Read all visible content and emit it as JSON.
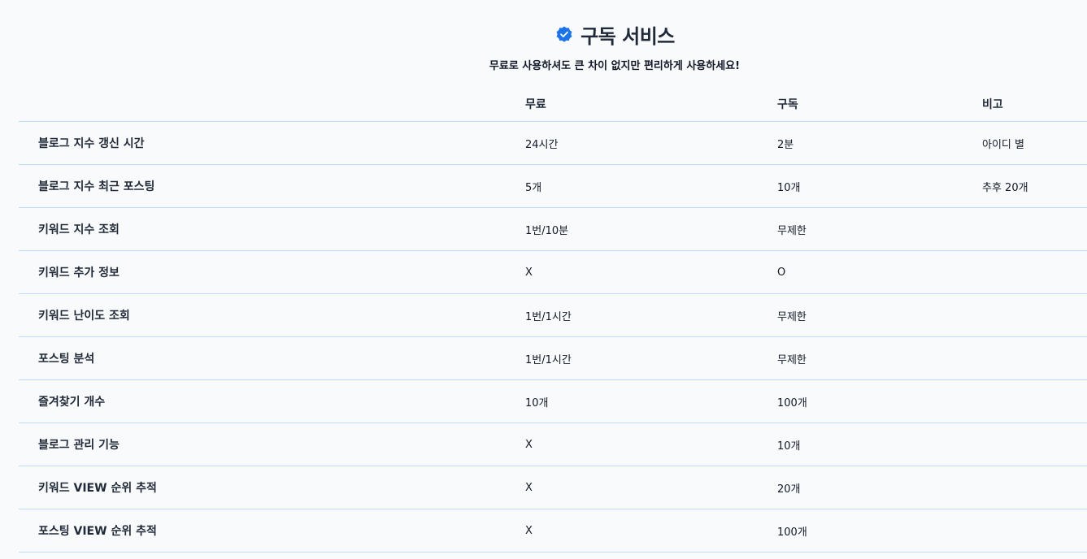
{
  "header": {
    "icon": "verified-badge-icon",
    "title": "구독 서비스",
    "subtitle": "무료로 사용하셔도 큰 차이 없지만 편리하게 사용하세요!",
    "accent_color": "#1a73e8"
  },
  "table": {
    "columns": [
      "",
      "무료",
      "구독",
      "비고"
    ],
    "rows": [
      {
        "feature": "블로그 지수 갱신 시간",
        "free": "24시간",
        "sub": "2분",
        "note": "아이디 별"
      },
      {
        "feature": "블로그 지수 최근 포스팅",
        "free": "5개",
        "sub": "10개",
        "note": "추후 20개"
      },
      {
        "feature": "키워드 지수 조회",
        "free": "1번/10분",
        "sub": "무제한",
        "note": ""
      },
      {
        "feature": "키워드 추가 정보",
        "free": "X",
        "sub": "O",
        "note": ""
      },
      {
        "feature": "키워드 난이도 조회",
        "free": "1번/1시간",
        "sub": "무제한",
        "note": ""
      },
      {
        "feature": "포스팅 분석",
        "free": "1번/1시간",
        "sub": "무제한",
        "note": ""
      },
      {
        "feature": "즐겨찾기 개수",
        "free": "10개",
        "sub": "100개",
        "note": ""
      },
      {
        "feature": "블로그 관리 기능",
        "free": "X",
        "sub": "10개",
        "note": ""
      },
      {
        "feature": "키워드 VIEW 순위 추적",
        "free": "X",
        "sub": "20개",
        "note": ""
      },
      {
        "feature": "포스팅 VIEW 순위 추적",
        "free": "X",
        "sub": "100개",
        "note": ""
      }
    ]
  }
}
